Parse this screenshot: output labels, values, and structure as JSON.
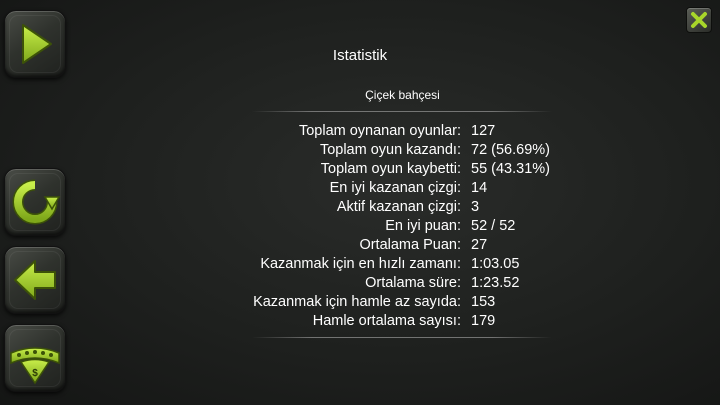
{
  "title": "Istatistik",
  "subtitle": "Çiçek bahçesi",
  "stats": [
    {
      "label": "Toplam oynanan oyunlar:",
      "value": "127"
    },
    {
      "label": "Toplam oyun kazandı:",
      "value": "72 (56.69%)"
    },
    {
      "label": "Toplam oyun kaybetti:",
      "value": "55 (43.31%)"
    },
    {
      "label": "En iyi kazanan çizgi:",
      "value": "14"
    },
    {
      "label": "Aktif kazanan çizgi:",
      "value": "3"
    },
    {
      "label": "En iyi puan:",
      "value": "52 / 52"
    },
    {
      "label": "Ortalama Puan:",
      "value": "27"
    },
    {
      "label": "Kazanmak için en hızlı zamanı:",
      "value": "1:03.05"
    },
    {
      "label": "Ortalama süre:",
      "value": "1:23.52"
    },
    {
      "label": "Kazanmak için hamle az sayıda:",
      "value": "153"
    },
    {
      "label": "Hamle ortalama sayısı:",
      "value": "179"
    }
  ],
  "sidebar": {
    "buttons": [
      {
        "icon": "play-icon"
      },
      {
        "icon": "refresh-icon"
      },
      {
        "icon": "back-arrow-icon"
      },
      {
        "icon": "vegas-icon",
        "sign_text": "VEGAS",
        "symbol": "$"
      }
    ]
  },
  "close": {
    "icon": "close-icon"
  },
  "colors": {
    "accent_green": "#a8d62a",
    "background": "#1e201e",
    "text": "#ffffff"
  }
}
